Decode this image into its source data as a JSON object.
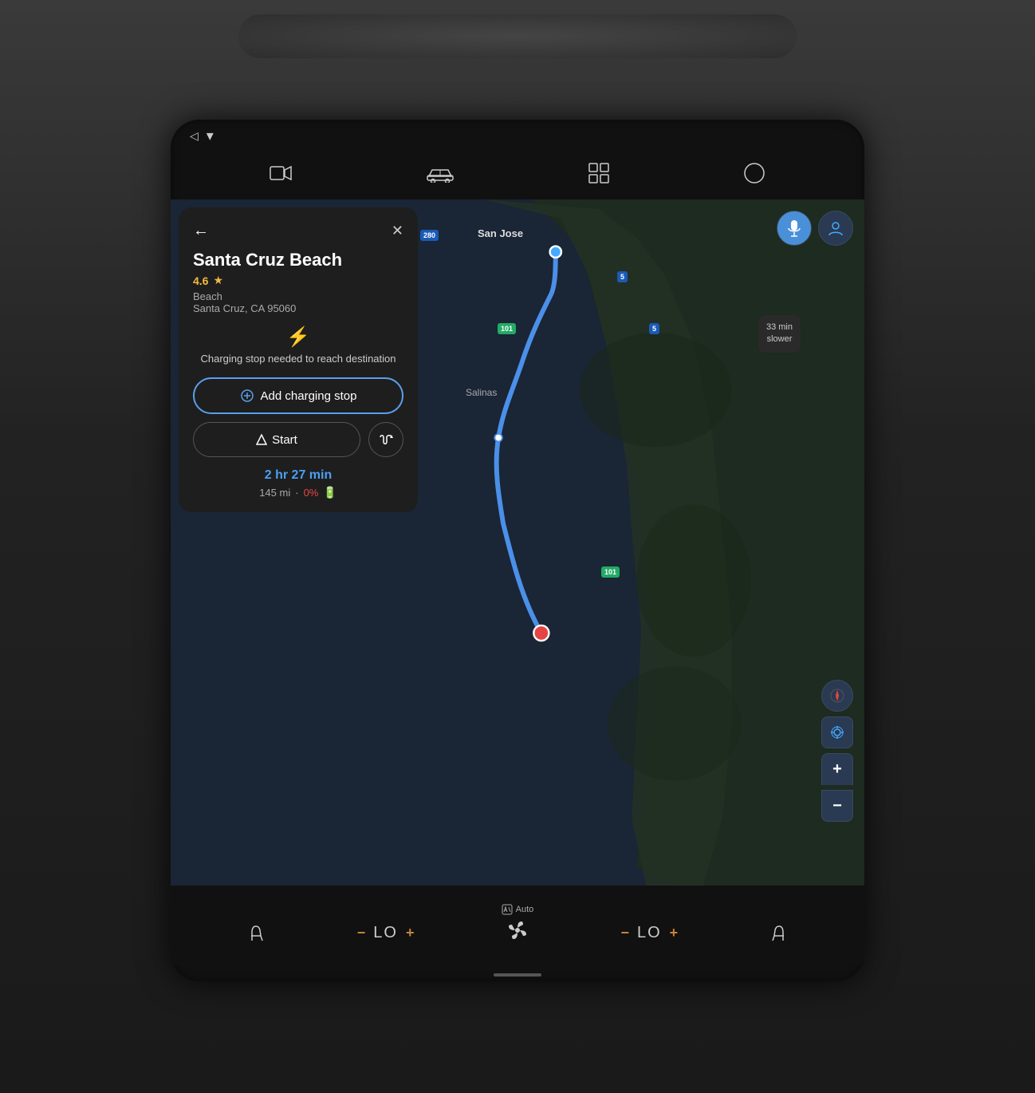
{
  "status_bar": {
    "nav_icon": "◁",
    "wifi_icon": "▾"
  },
  "top_nav": {
    "camera_icon": "▣",
    "car_icon": "🚗",
    "grid_icon": "⊞",
    "circle_icon": "○"
  },
  "map": {
    "route_time": "2 hr 27 min",
    "traffic_label": "33 min\nslower",
    "san_jose_label": "San Jose",
    "salinas_label": "Salinas",
    "mic_icon": "🎤",
    "account_icon": "👤",
    "compass_icon": "▲",
    "locate_icon": "◎",
    "zoom_in": "+",
    "zoom_out": "−"
  },
  "info_panel": {
    "back_icon": "←",
    "close_icon": "✕",
    "place_name": "Santa Cruz Beach",
    "rating": "4.6",
    "star": "★",
    "place_type": "Beach",
    "place_address": "Santa Cruz, CA 95060",
    "bolt_icon": "⚡",
    "charging_notice": "Charging stop needed to\nreach destination",
    "add_charging_label": "Add charging stop",
    "charging_pin_icon": "⊕",
    "start_icon": "△",
    "start_label": "Start",
    "options_icon": "⇄",
    "trip_time": "2 hr 27 min",
    "trip_distance": "145 mi",
    "battery_percent": "0%",
    "battery_icon": "🔋"
  },
  "climate": {
    "auto_icon": "⊡",
    "auto_label": "Auto",
    "seat_left_icon": "🪑",
    "left_minus": "−",
    "left_level": "LO",
    "left_plus": "+",
    "fan_icon": "✿",
    "right_minus": "−",
    "right_level": "LO",
    "right_plus": "+",
    "seat_right_icon": "🪑"
  }
}
